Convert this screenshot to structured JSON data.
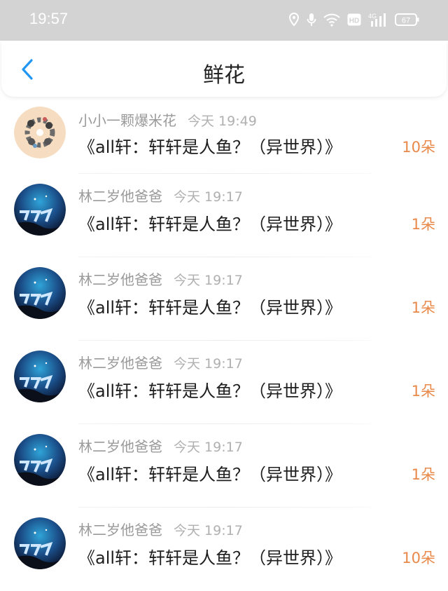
{
  "status_bar": {
    "time": "19:57",
    "battery": "67",
    "network_label": "4G",
    "hd_label": "HD",
    "icons": [
      "location-icon",
      "microphone-icon",
      "wifi-icon",
      "hd-icon",
      "signal-icon",
      "battery-icon"
    ]
  },
  "header": {
    "title": "鲜花",
    "back_icon": "chevron-left-icon"
  },
  "colors": {
    "accent": "#2196f3",
    "amount": "#e8894a",
    "status_bar_bg": "#d3d3d3"
  },
  "gifts": [
    {
      "user": "小小一颗爆米花",
      "time": "今天 19:49",
      "message": "《all轩：轩轩是人鱼？（异世界）》",
      "amount": "10朵"
    },
    {
      "user": "林二岁他爸爸",
      "time": "今天 19:17",
      "message": "《all轩：轩轩是人鱼？（异世界）》",
      "amount": "1朵"
    },
    {
      "user": "林二岁他爸爸",
      "time": "今天 19:17",
      "message": "《all轩：轩轩是人鱼？（异世界）》",
      "amount": "1朵"
    },
    {
      "user": "林二岁他爸爸",
      "time": "今天 19:17",
      "message": "《all轩：轩轩是人鱼？（异世界）》",
      "amount": "1朵"
    },
    {
      "user": "林二岁他爸爸",
      "time": "今天 19:17",
      "message": "《all轩：轩轩是人鱼？（异世界）》",
      "amount": "1朵"
    },
    {
      "user": "林二岁他爸爸",
      "time": "今天 19:17",
      "message": "《all轩：轩轩是人鱼？（异世界）》",
      "amount": "10朵"
    }
  ]
}
